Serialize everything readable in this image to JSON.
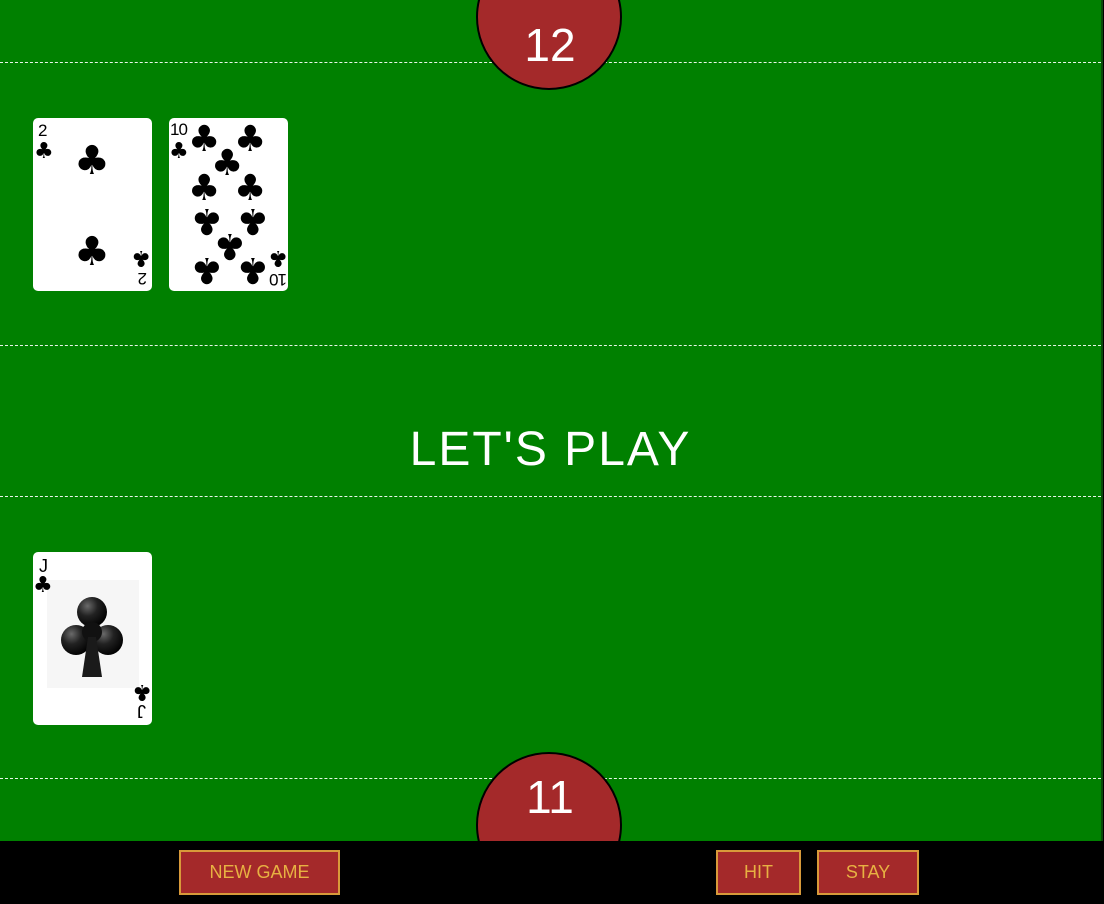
{
  "scores": {
    "dealer": "12",
    "player": "11"
  },
  "message": "LET'S PLAY",
  "dealer_hand": [
    {
      "rank": "2",
      "suit": "clubs",
      "suit_symbol": "♣"
    },
    {
      "rank": "10",
      "suit": "clubs",
      "suit_symbol": "♣"
    }
  ],
  "player_hand": [
    {
      "rank": "J",
      "suit": "clubs",
      "suit_symbol": "♣"
    }
  ],
  "buttons": {
    "new_game": "NEW GAME",
    "hit": "HIT",
    "stay": "STAY"
  },
  "colors": {
    "felt": "#008000",
    "score_disc": "#a4292a",
    "button_bg": "#a4292a",
    "button_text": "#e7b142",
    "footer": "#000000"
  }
}
